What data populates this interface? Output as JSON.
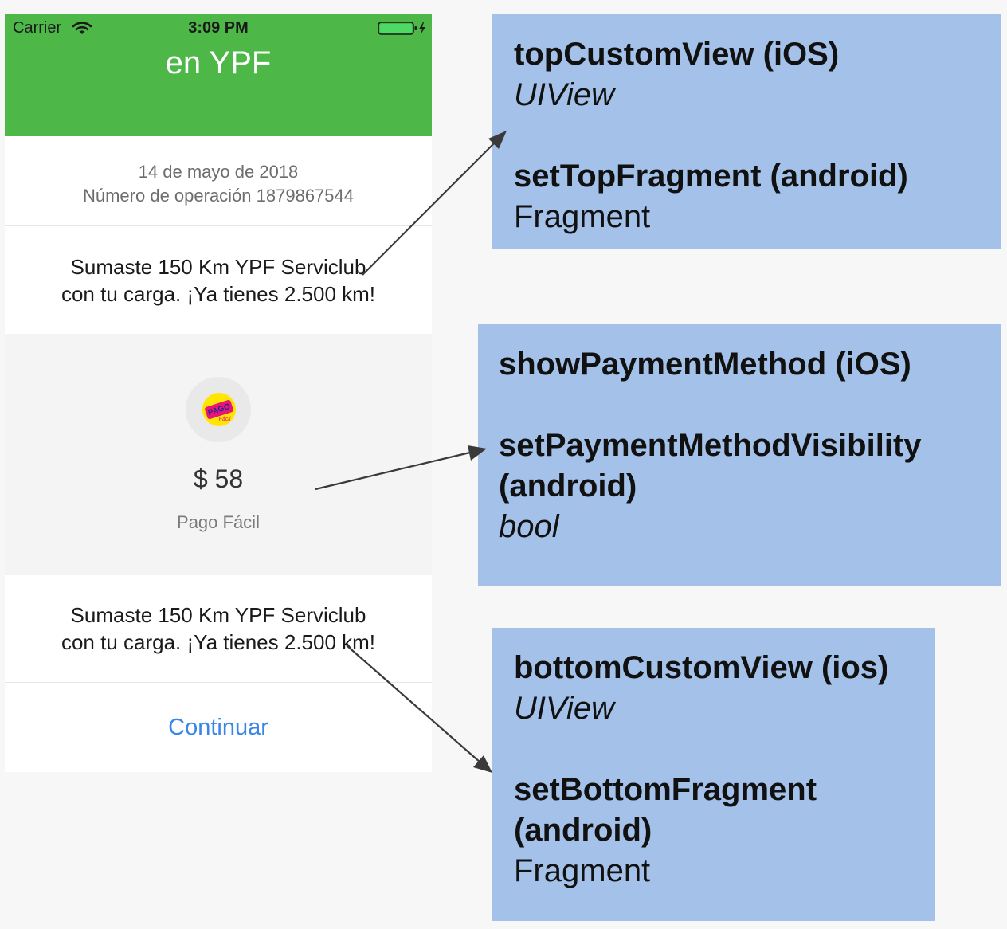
{
  "phone": {
    "status_bar": {
      "carrier": "Carrier",
      "time": "3:09 PM"
    },
    "title": "en YPF",
    "date": "14 de mayo de 2018",
    "operation": "Número de operación 1879867544",
    "top_message": "Sumaste 150 Km YPF Serviclub con tu carga. ¡Ya tienes 2.500 km!",
    "payment": {
      "amount": "$ 58",
      "method": "Pago Fácil",
      "logo_text": "PAGO",
      "logo_subtext": "Fácil"
    },
    "bottom_message": "Sumaste 150 Km YPF Serviclub con tu carga. ¡Ya tienes 2.500 km!",
    "continue_label": "Continuar"
  },
  "annotations": {
    "top": {
      "ios_name": "topCustomView (iOS)",
      "ios_type": "UIView",
      "android_name": "setTopFragment (android)",
      "android_type": "Fragment"
    },
    "middle": {
      "ios_name": "showPaymentMethod (iOS)",
      "android_name_line1": "setPaymentMethodVisibility",
      "android_name_line2": "(android)",
      "type": "bool"
    },
    "bottom": {
      "ios_name": "bottomCustomView (ios)",
      "ios_type": "UIView",
      "android_name_line1": "setBottomFragment",
      "android_name_line2": "(android)",
      "android_type": "Fragment"
    }
  },
  "colors": {
    "header": "#4db848",
    "note_background": "#a4c2e9",
    "link": "#3a86e8",
    "arrow": "#3a3a3a"
  }
}
